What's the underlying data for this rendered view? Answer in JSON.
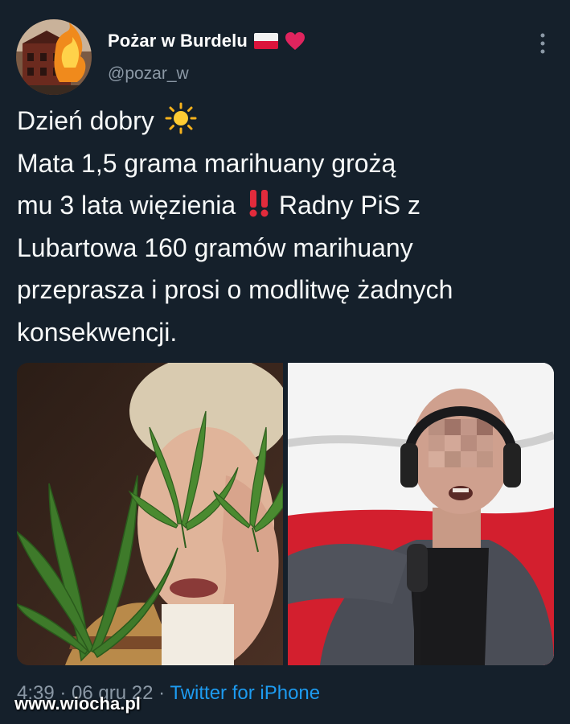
{
  "user": {
    "display_name": "Pożar w Burdelu",
    "handle": "@pozar_w",
    "avatar_icon": "burning-building-avatar",
    "flag_icon": "poland-flag-icon",
    "heart_icon": "red-heart-icon",
    "heart_color": "#e0245e"
  },
  "tweet": {
    "line1": "Dzień dobry",
    "line2": "Mata 1,5 grama marihuany grożą",
    "line3a": "mu 3 lata więzienia",
    "line3b": "Radny PiS z",
    "line4": "Lubartowa 160 gramów marihuany",
    "line5": "przeprasza i prosi o modlitwę żadnych",
    "line6": "konsekwencji.",
    "sun_icon": "sun-emoji-icon",
    "exclamation_icon": "double-exclamation-emoji-icon"
  },
  "media": {
    "left_image": "man-covering-face-cannabis-leaves",
    "right_image": "man-headphones-microphone-pixelated-face"
  },
  "meta": {
    "timestamp": "4:39 · 06 gru 22",
    "separator": "·",
    "source": "Twitter for iPhone"
  },
  "watermark": "www.wiocha.pl",
  "colors": {
    "background": "#15202b",
    "text": "#f7f9f9",
    "secondary": "#8b98a5",
    "link": "#1d9bf0"
  }
}
